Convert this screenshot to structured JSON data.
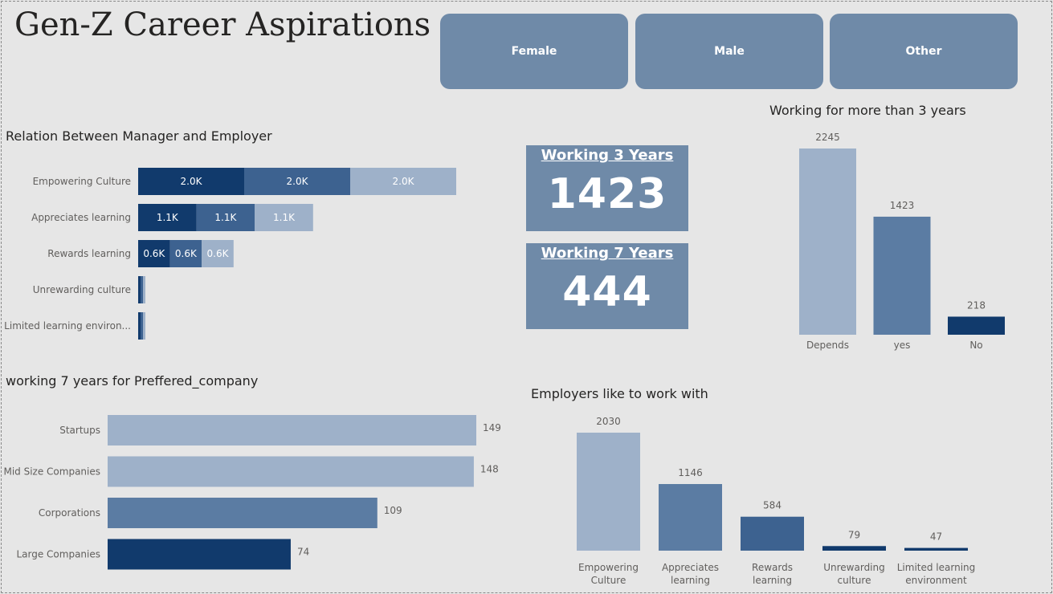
{
  "title": "Gen-Z Career Aspirations",
  "slicers": [
    "Female",
    "Male",
    "Other"
  ],
  "colors": {
    "dark": "#113a6c",
    "mid": "#3d6290",
    "light": "#9eb1c9",
    "mid2": "#5b7ca3",
    "card": "#6f8aa8"
  },
  "cards": [
    {
      "label": "Working 3 Years",
      "value": "1423"
    },
    {
      "label": "Working 7 Years",
      "value": "444"
    }
  ],
  "chart_data": [
    {
      "type": "bar",
      "orientation": "horizontal-stacked",
      "title": "Relation Between Manager and Employer",
      "categories": [
        "Empowering Culture",
        "Appreciates learning",
        "Rewards learning",
        "Unrewarding culture",
        "Limited learning environ..."
      ],
      "series": [
        {
          "values": [
            2.0,
            1.1,
            0.6,
            0.03,
            0.02
          ]
        },
        {
          "values": [
            2.0,
            1.1,
            0.6,
            0.03,
            0.02
          ]
        },
        {
          "values": [
            2.0,
            1.1,
            0.6,
            0.03,
            0.02
          ]
        }
      ],
      "data_labels": [
        [
          "2.0K",
          "2.0K",
          "2.0K"
        ],
        [
          "1.1K",
          "1.1K",
          "1.1K"
        ],
        [
          "0.6K",
          "0.6K",
          "0.6K"
        ],
        [
          "",
          "",
          ""
        ],
        [
          "",
          "",
          ""
        ]
      ]
    },
    {
      "type": "bar",
      "orientation": "horizontal",
      "title": "working 7 years for Preffered_company",
      "categories": [
        "Startups",
        "Mid Size Companies",
        "Corporations",
        "Large Companies"
      ],
      "values": [
        149,
        148,
        109,
        74
      ]
    },
    {
      "type": "bar",
      "title": "Working for more than 3 years",
      "categories": [
        "Depends",
        "yes",
        "No"
      ],
      "values": [
        2245,
        1423,
        218
      ]
    },
    {
      "type": "bar",
      "title": "Employers like to work with",
      "categories": [
        [
          "Empowering",
          "Culture"
        ],
        [
          "Appreciates",
          "learning"
        ],
        [
          "Rewards",
          "learning"
        ],
        [
          "Unrewarding",
          "culture"
        ],
        [
          "Limited learning",
          "environment"
        ]
      ],
      "values": [
        2030,
        1146,
        584,
        79,
        47
      ]
    }
  ]
}
